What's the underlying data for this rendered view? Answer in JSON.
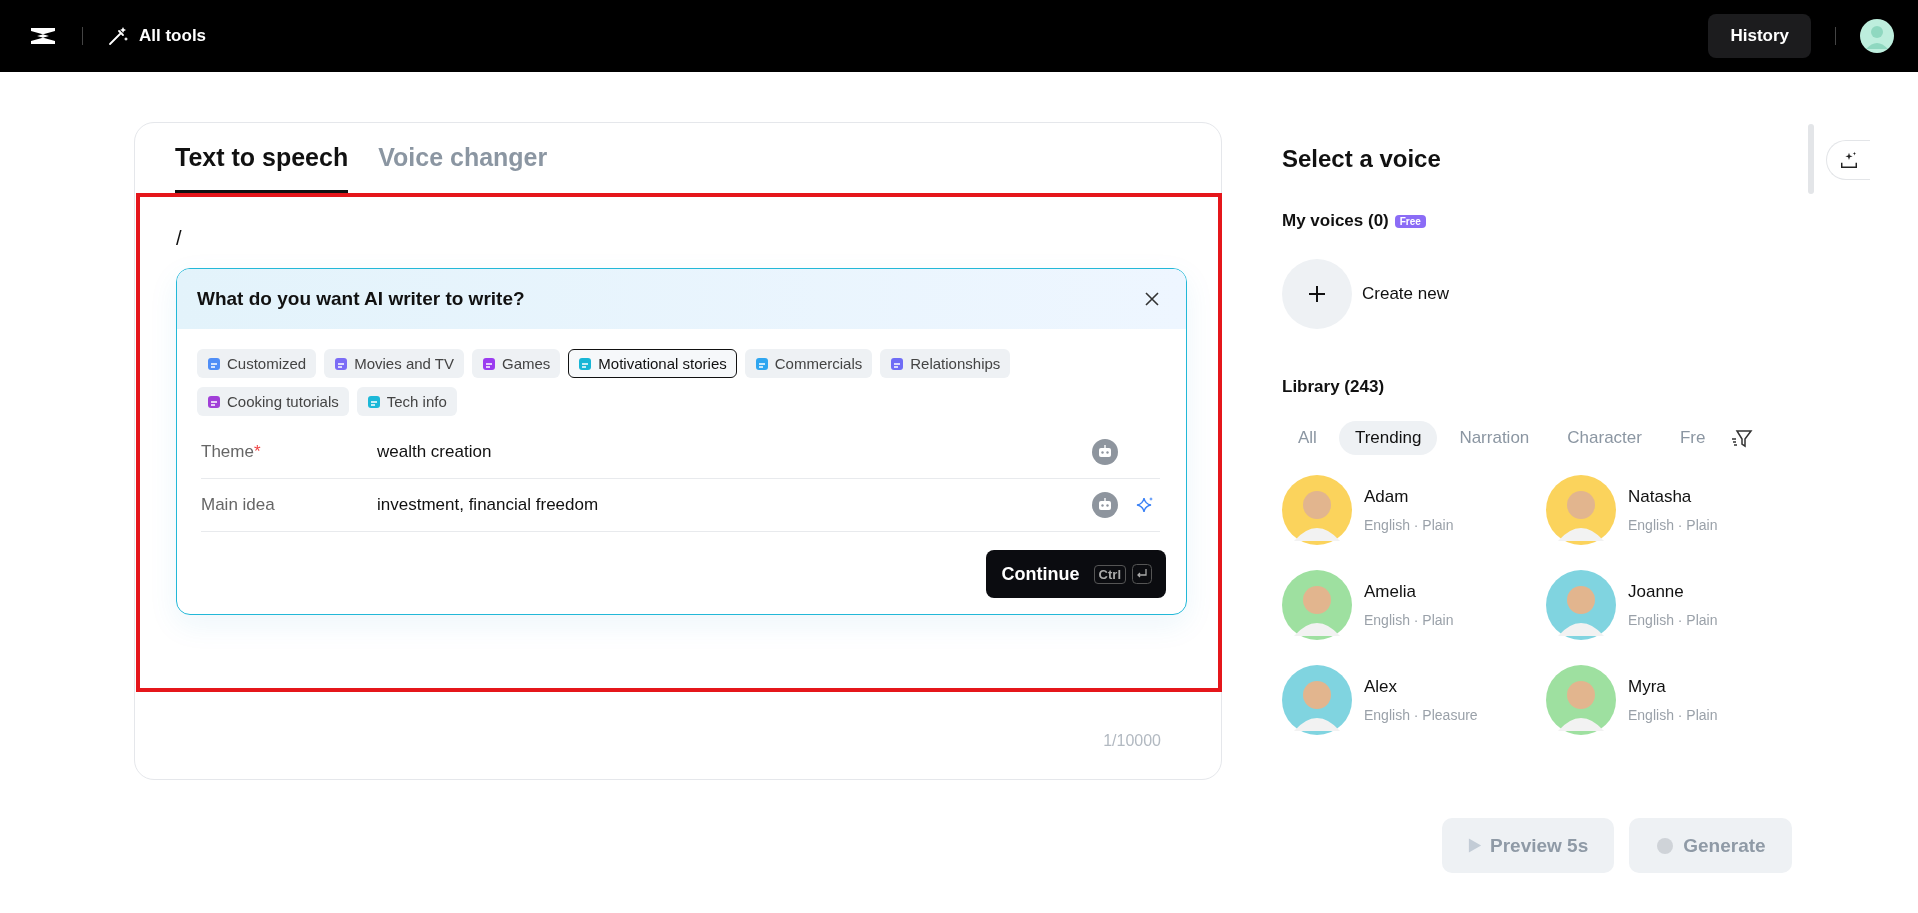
{
  "top_bar": {
    "all_tools": "All tools",
    "history": "History"
  },
  "tabs": [
    {
      "label": "Text to speech",
      "selected": true
    },
    {
      "label": "Voice changer",
      "selected": false
    }
  ],
  "editor": {
    "text": "/",
    "counter": "1/10000"
  },
  "ai_writer": {
    "title": "What do you want AI writer to write?",
    "chips": [
      {
        "label": "Customized",
        "selected": false,
        "color": "#4f8ef7"
      },
      {
        "label": "Movies and TV",
        "selected": false,
        "color": "#7b6cf6"
      },
      {
        "label": "Games",
        "selected": false,
        "color": "#9b3cf0"
      },
      {
        "label": "Motivational stories",
        "selected": true,
        "color": "#18b6d6"
      },
      {
        "label": "Commercials",
        "selected": false,
        "color": "#2fa6f0"
      },
      {
        "label": "Relationships",
        "selected": false,
        "color": "#6f6cf6"
      },
      {
        "label": "Cooking tutorials",
        "selected": false,
        "color": "#a13fd8"
      },
      {
        "label": "Tech info",
        "selected": false,
        "color": "#1cb8d8"
      }
    ],
    "fields": [
      {
        "label": "Theme",
        "required_mark": "*",
        "value": "wealth creation"
      },
      {
        "label": "Main idea",
        "value": "investment, financial freedom",
        "sparkle": true
      }
    ],
    "continue": {
      "label": "Continue",
      "key": "Ctrl"
    }
  },
  "voice_panel": {
    "title": "Select a voice",
    "my_voices": "My voices (0)",
    "badge": "Free",
    "create_new": "Create new",
    "library": "Library (243)",
    "filters": [
      {
        "label": "All",
        "selected": false
      },
      {
        "label": "Trending",
        "selected": true
      },
      {
        "label": "Narration",
        "selected": false
      },
      {
        "label": "Character",
        "selected": false
      },
      {
        "label": "Fre",
        "selected": false
      }
    ],
    "voices": [
      {
        "name": "Adam",
        "desc": "English · Plain",
        "color": "#fbd35c"
      },
      {
        "name": "Natasha",
        "desc": "English · Plain",
        "color": "#fbd35c"
      },
      {
        "name": "Amelia",
        "desc": "English · Plain",
        "color": "#9ee0a0"
      },
      {
        "name": "Joanne",
        "desc": "English · Plain",
        "color": "#80d4e0"
      },
      {
        "name": "Alex",
        "desc": "English · Pleasure",
        "color": "#80d4e0"
      },
      {
        "name": "Myra",
        "desc": "English · Plain",
        "color": "#9ee0a0"
      }
    ]
  },
  "actions": [
    {
      "label": "Preview 5s",
      "kind": "preview",
      "disabled": true
    },
    {
      "label": "Generate",
      "kind": "generate",
      "disabled": true
    }
  ]
}
